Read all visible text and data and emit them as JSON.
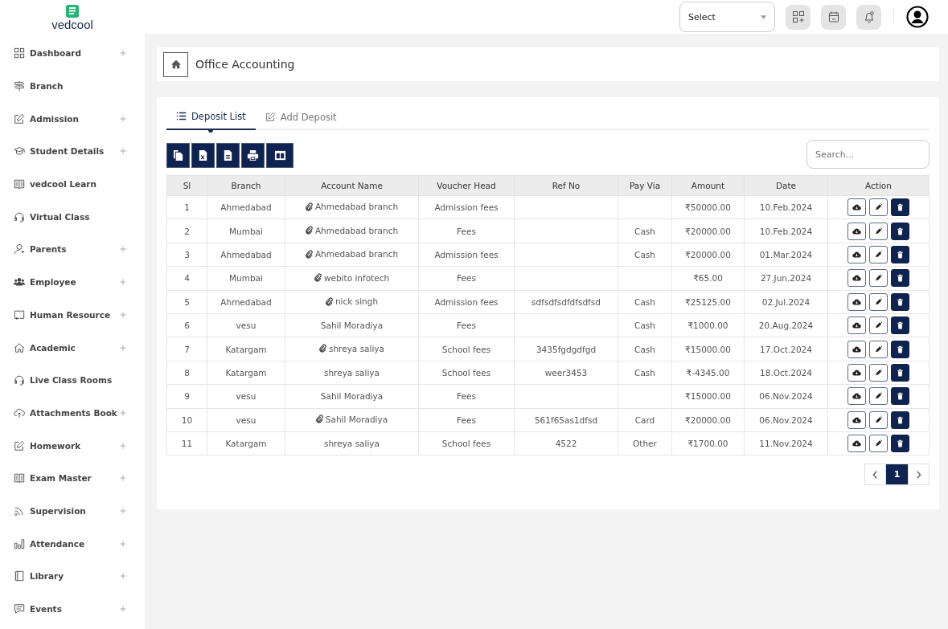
{
  "header": {
    "logo": "vedcool",
    "select": {
      "value": "Select"
    }
  },
  "sidebar": {
    "items": [
      {
        "label": "Dashboard",
        "expandable": true
      },
      {
        "label": "Branch",
        "expandable": false
      },
      {
        "label": "Admission",
        "expandable": true
      },
      {
        "label": "Student Details",
        "expandable": true
      },
      {
        "label": "vedcool Learn",
        "expandable": false
      },
      {
        "label": "Virtual Class",
        "expandable": false
      },
      {
        "label": "Parents",
        "expandable": true
      },
      {
        "label": "Employee",
        "expandable": true
      },
      {
        "label": "Human Resource",
        "expandable": true
      },
      {
        "label": "Academic",
        "expandable": true
      },
      {
        "label": "Live Class Rooms",
        "expandable": false
      },
      {
        "label": "Attachments Book",
        "expandable": true
      },
      {
        "label": "Homework",
        "expandable": true
      },
      {
        "label": "Exam Master",
        "expandable": true
      },
      {
        "label": "Supervision",
        "expandable": true
      },
      {
        "label": "Attendance",
        "expandable": true
      },
      {
        "label": "Library",
        "expandable": true
      },
      {
        "label": "Events",
        "expandable": true
      }
    ]
  },
  "breadcrumb": {
    "title": "Office Accounting"
  },
  "tabs": [
    {
      "label": "Deposit List",
      "selected": true
    },
    {
      "label": "Add Deposit",
      "selected": false
    }
  ],
  "search": {
    "placeholder": "Search..."
  },
  "table": {
    "columns": [
      "Sl",
      "Branch",
      "Account Name",
      "Voucher Head",
      "Ref No",
      "Pay Via",
      "Amount",
      "Date",
      "Action"
    ],
    "rows": [
      {
        "sl": "1",
        "branch": "Ahmedabad",
        "account": "Ahmedabad branch",
        "attachment": true,
        "voucher": "Admission fees",
        "ref": "",
        "pay": "",
        "amount": "₹50000.00",
        "date": "10.Feb.2024"
      },
      {
        "sl": "2",
        "branch": "Mumbai",
        "account": "Ahmedabad branch",
        "attachment": true,
        "voucher": "Fees",
        "ref": "",
        "pay": "Cash",
        "amount": "₹20000.00",
        "date": "10.Feb.2024"
      },
      {
        "sl": "3",
        "branch": "Ahmedabad",
        "account": "Ahmedabad branch",
        "attachment": true,
        "voucher": "Admission fees",
        "ref": "",
        "pay": "Cash",
        "amount": "₹20000.00",
        "date": "01.Mar.2024"
      },
      {
        "sl": "4",
        "branch": "Mumbai",
        "account": "webito infotech",
        "attachment": true,
        "voucher": "Fees",
        "ref": "",
        "pay": "",
        "amount": "₹65.00",
        "date": "27.Jun.2024"
      },
      {
        "sl": "5",
        "branch": "Ahmedabad",
        "account": "nick singh",
        "attachment": true,
        "voucher": "Admission fees",
        "ref": "sdfsdfsdfdfsdfsd",
        "pay": "Cash",
        "amount": "₹25125.00",
        "date": "02.Jul.2024"
      },
      {
        "sl": "6",
        "branch": "vesu",
        "account": "Sahil Moradiya",
        "attachment": false,
        "voucher": "Fees",
        "ref": "",
        "pay": "Cash",
        "amount": "₹1000.00",
        "date": "20.Aug.2024"
      },
      {
        "sl": "7",
        "branch": "Katargam",
        "account": "shreya saliya",
        "attachment": true,
        "voucher": "School fees",
        "ref": "3435fgdgdfgd",
        "pay": "Cash",
        "amount": "₹15000.00",
        "date": "17.Oct.2024"
      },
      {
        "sl": "8",
        "branch": "Katargam",
        "account": "shreya saliya",
        "attachment": false,
        "voucher": "School fees",
        "ref": "weer3453",
        "pay": "Cash",
        "amount": "₹-4345.00",
        "date": "18.Oct.2024"
      },
      {
        "sl": "9",
        "branch": "vesu",
        "account": "Sahil Moradiya",
        "attachment": false,
        "voucher": "Fees",
        "ref": "",
        "pay": "",
        "amount": "₹15000.00",
        "date": "06.Nov.2024"
      },
      {
        "sl": "10",
        "branch": "vesu",
        "account": "Sahil Moradiya",
        "attachment": true,
        "voucher": "Fees",
        "ref": "561f65as1dfsd",
        "pay": "Card",
        "amount": "₹20000.00",
        "date": "06.Nov.2024"
      },
      {
        "sl": "11",
        "branch": "Katargam",
        "account": "shreya saliya",
        "attachment": false,
        "voucher": "School fees",
        "ref": "4522",
        "pay": "Other",
        "amount": "₹1700.00",
        "date": "11.Nov.2024"
      }
    ]
  },
  "pagination": {
    "pages": [
      {
        "label": "1",
        "selected": true
      }
    ]
  }
}
